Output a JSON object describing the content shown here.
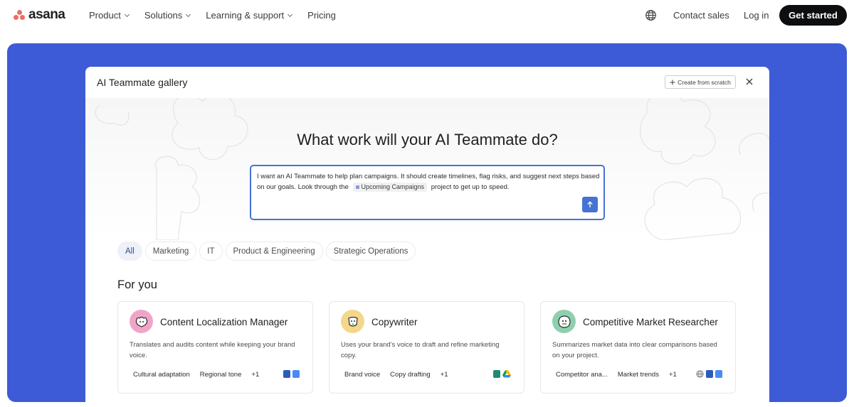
{
  "nav": {
    "logo": "asana",
    "items": [
      {
        "label": "Product"
      },
      {
        "label": "Solutions"
      },
      {
        "label": "Learning & support"
      }
    ],
    "pricing": "Pricing",
    "contact_sales": "Contact sales",
    "login": "Log in",
    "get_started": "Get started"
  },
  "modal": {
    "title": "AI Teammate gallery",
    "create_button": "Create from scratch",
    "heading": "What work will your AI Teammate do?",
    "prompt": {
      "text_before": "I want an AI Teammate to help plan campaigns. It should create timelines, flag risks, and suggest next steps based on our goals. Look through the",
      "chip": "Upcoming Campaigns",
      "text_after": "project to get up to speed."
    },
    "tabs": [
      "All",
      "Marketing",
      "IT",
      "Product & Engineering",
      "Strategic Operations"
    ],
    "active_tab": "All",
    "section_title": "For you",
    "cards": [
      {
        "title": "Content Localization Manager",
        "description": "Translates and audits content while keeping your brand voice.",
        "tags": [
          "Cultural adaptation",
          "Regional tone",
          "+1"
        ],
        "avatar_color": "#f0a5c8"
      },
      {
        "title": "Copywriter",
        "description": "Uses your brand's voice to draft and refine marketing copy.",
        "tags": [
          "Brand voice",
          "Copy drafting",
          "+1"
        ],
        "avatar_color": "#f3d78a"
      },
      {
        "title": "Competitive Market Researcher",
        "description": "Summarizes market data into clear comparisons based on your project.",
        "tags": [
          "Competitor ana...",
          "Market trends",
          "+1"
        ],
        "avatar_color": "#8ed0ae"
      }
    ]
  },
  "colors": {
    "brand_blue": "#3d5bd6",
    "accent": "#4573d2",
    "logo_coral": "#f06a6a"
  }
}
